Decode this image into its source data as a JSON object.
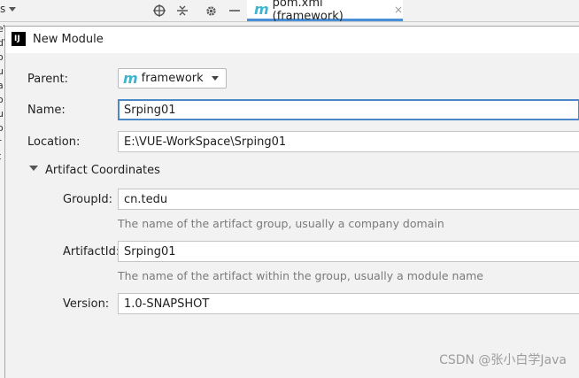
{
  "ide": {
    "left_text": "s",
    "tab": {
      "icon": "maven-m-icon",
      "icon_glyph": "m",
      "label": "pom.xml (framework)",
      "close": "×"
    },
    "icons": [
      "target-icon",
      "collapse-icon",
      "gear-icon",
      "minimize-icon"
    ],
    "left_strip_lines": [
      "e\\",
      "d\\",
      "o",
      "u",
      "a",
      "o",
      "u",
      "o",
      "r",
      "t",
      "o"
    ]
  },
  "dialog": {
    "title": "New Module",
    "logo": "IJ",
    "parent": {
      "label": "Parent:",
      "value": "framework",
      "icon_glyph": "m"
    },
    "name": {
      "label": "Name:",
      "value": "Srping01"
    },
    "location": {
      "label": "Location:",
      "value": "E:\\VUE-WorkSpace\\Srping01"
    },
    "artifact": {
      "section_label": "Artifact Coordinates",
      "group_id": {
        "label": "GroupId:",
        "value": "cn.tedu",
        "hint": "The name of the artifact group, usually a company domain"
      },
      "artifact_id": {
        "label": "ArtifactId:",
        "value": "Srping01",
        "hint": "The name of the artifact within the group, usually a module name"
      },
      "version": {
        "label": "Version:",
        "value": "1.0-SNAPSHOT"
      }
    }
  },
  "watermark": "CSDN @张小白学Java"
}
